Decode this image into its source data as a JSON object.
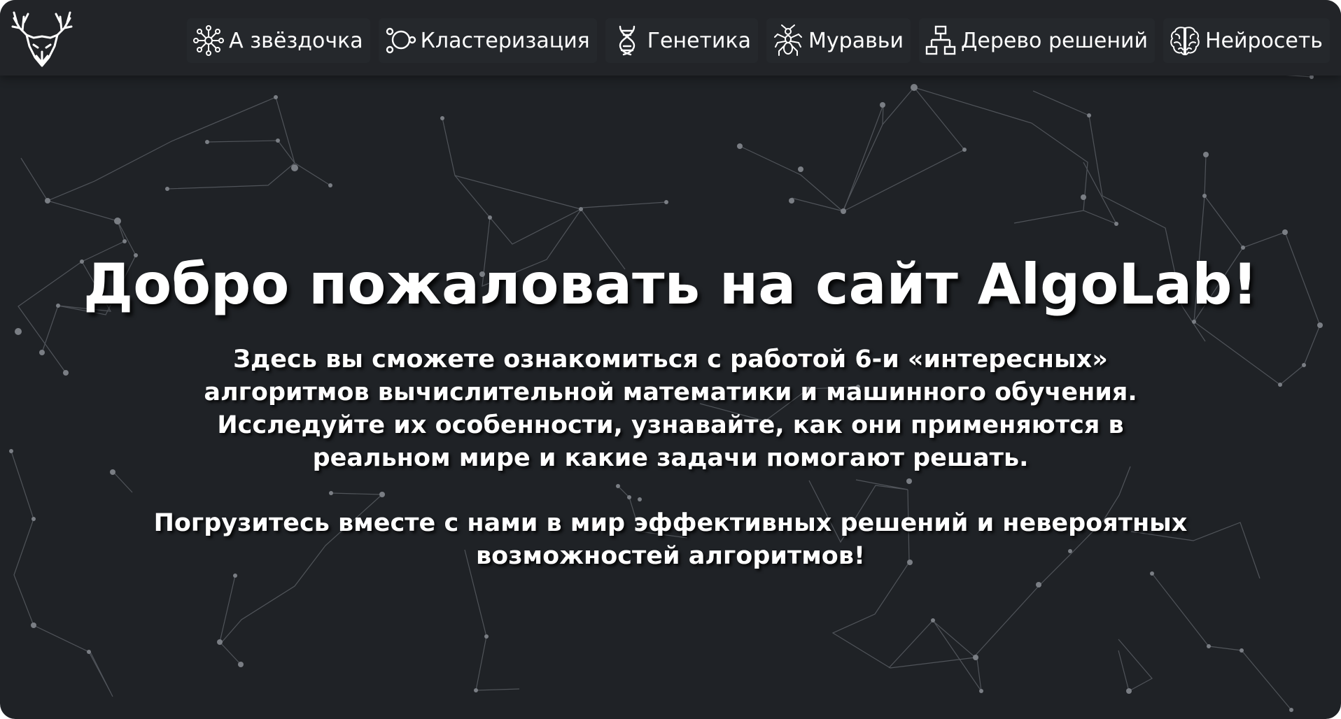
{
  "nav": {
    "items": [
      {
        "label": "А звёздочка",
        "icon": "astar-icon"
      },
      {
        "label": "Кластеризация",
        "icon": "cluster-icon"
      },
      {
        "label": "Генетика",
        "icon": "dna-icon"
      },
      {
        "label": "Муравьи",
        "icon": "ant-icon"
      },
      {
        "label": "Дерево решений",
        "icon": "decision-tree-icon"
      },
      {
        "label": "Нейросеть",
        "icon": "brain-icon"
      }
    ]
  },
  "hero": {
    "title": "Добро пожаловать на сайт AlgoLab!",
    "paragraph1": "Здесь вы сможете ознакомиться с работой 6-и «интересных» алгоритмов вычислительной математики и машинного обучения. Исследуйте их особенности, узнавайте, как они применяются в реальном мире и какие задачи помогают решать.",
    "paragraph2": "Погрузитесь вместе с нами в мир эффективных решений и невероятных возможностей алгоритмов!"
  },
  "colors": {
    "background": "#1f2226",
    "navbar": "#222428",
    "text": "#ffffff",
    "network": "#6b6f75"
  }
}
